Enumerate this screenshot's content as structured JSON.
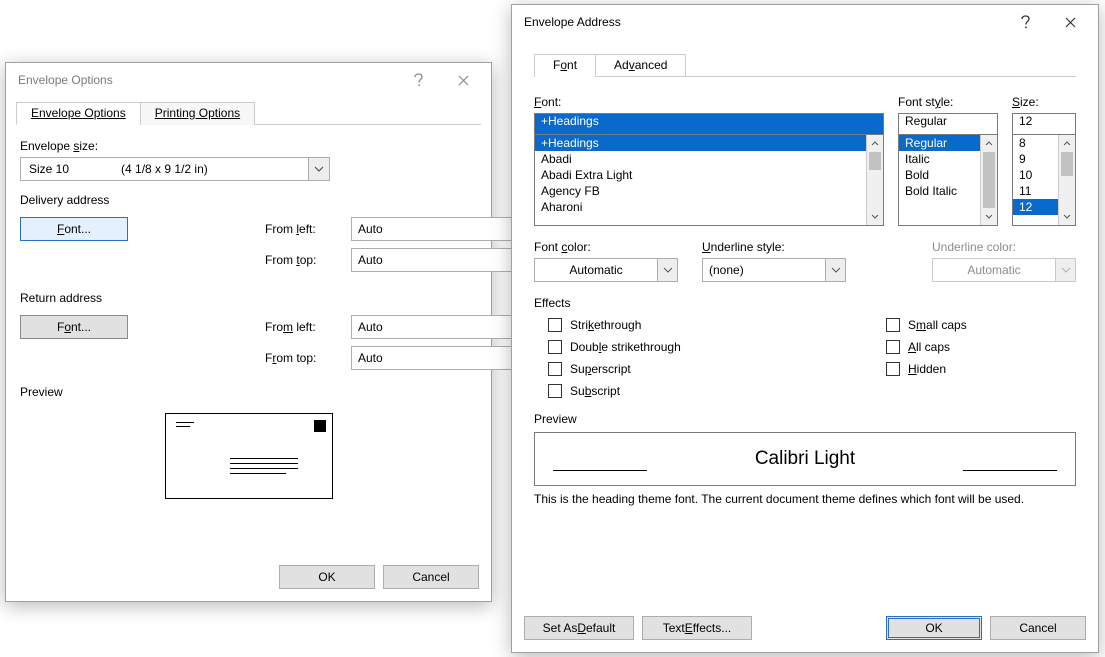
{
  "envelope": {
    "title": "Envelope Options",
    "tabs": {
      "options": "Envelope Options",
      "printing": "Printing Options"
    },
    "size_label": "Envelope size:",
    "size_value": "Size 10",
    "size_extra": "(4 1/8 x 9 1/2 in)",
    "delivery_label": "Delivery address",
    "return_label": "Return address",
    "font_btn": "Font...",
    "from_left": "From left:",
    "from_top": "From top:",
    "auto": "Auto",
    "preview": "Preview",
    "ok": "OK",
    "cancel": "Cancel"
  },
  "fontdlg": {
    "title": "Envelope Address",
    "tabs": {
      "font": "Font",
      "advanced": "Advanced"
    },
    "font_label": "Font:",
    "style_label": "Font style:",
    "size_label": "Size:",
    "font_value": "+Headings",
    "font_list": [
      "+Headings",
      "Abadi",
      "Abadi Extra Light",
      "Agency FB",
      "Aharoni"
    ],
    "style_value": "Regular",
    "style_list": [
      "Regular",
      "Italic",
      "Bold",
      "Bold Italic"
    ],
    "size_value": "12",
    "size_list": [
      "8",
      "9",
      "10",
      "11",
      "12"
    ],
    "font_color_label": "Font color:",
    "font_color_value": "Automatic",
    "underline_style_label": "Underline style:",
    "underline_style_value": "(none)",
    "underline_color_label": "Underline color:",
    "underline_color_value": "Automatic",
    "effects_label": "Effects",
    "effects_left": [
      "Strikethrough",
      "Double strikethrough",
      "Superscript",
      "Subscript"
    ],
    "effects_right": [
      "Small caps",
      "All caps",
      "Hidden"
    ],
    "preview_label": "Preview",
    "preview_sample": "Calibri Light",
    "preview_note": "This is the heading theme font. The current document theme defines which font will be used.",
    "set_default": "Set As Default",
    "text_effects": "Text Effects...",
    "ok": "OK",
    "cancel": "Cancel"
  }
}
